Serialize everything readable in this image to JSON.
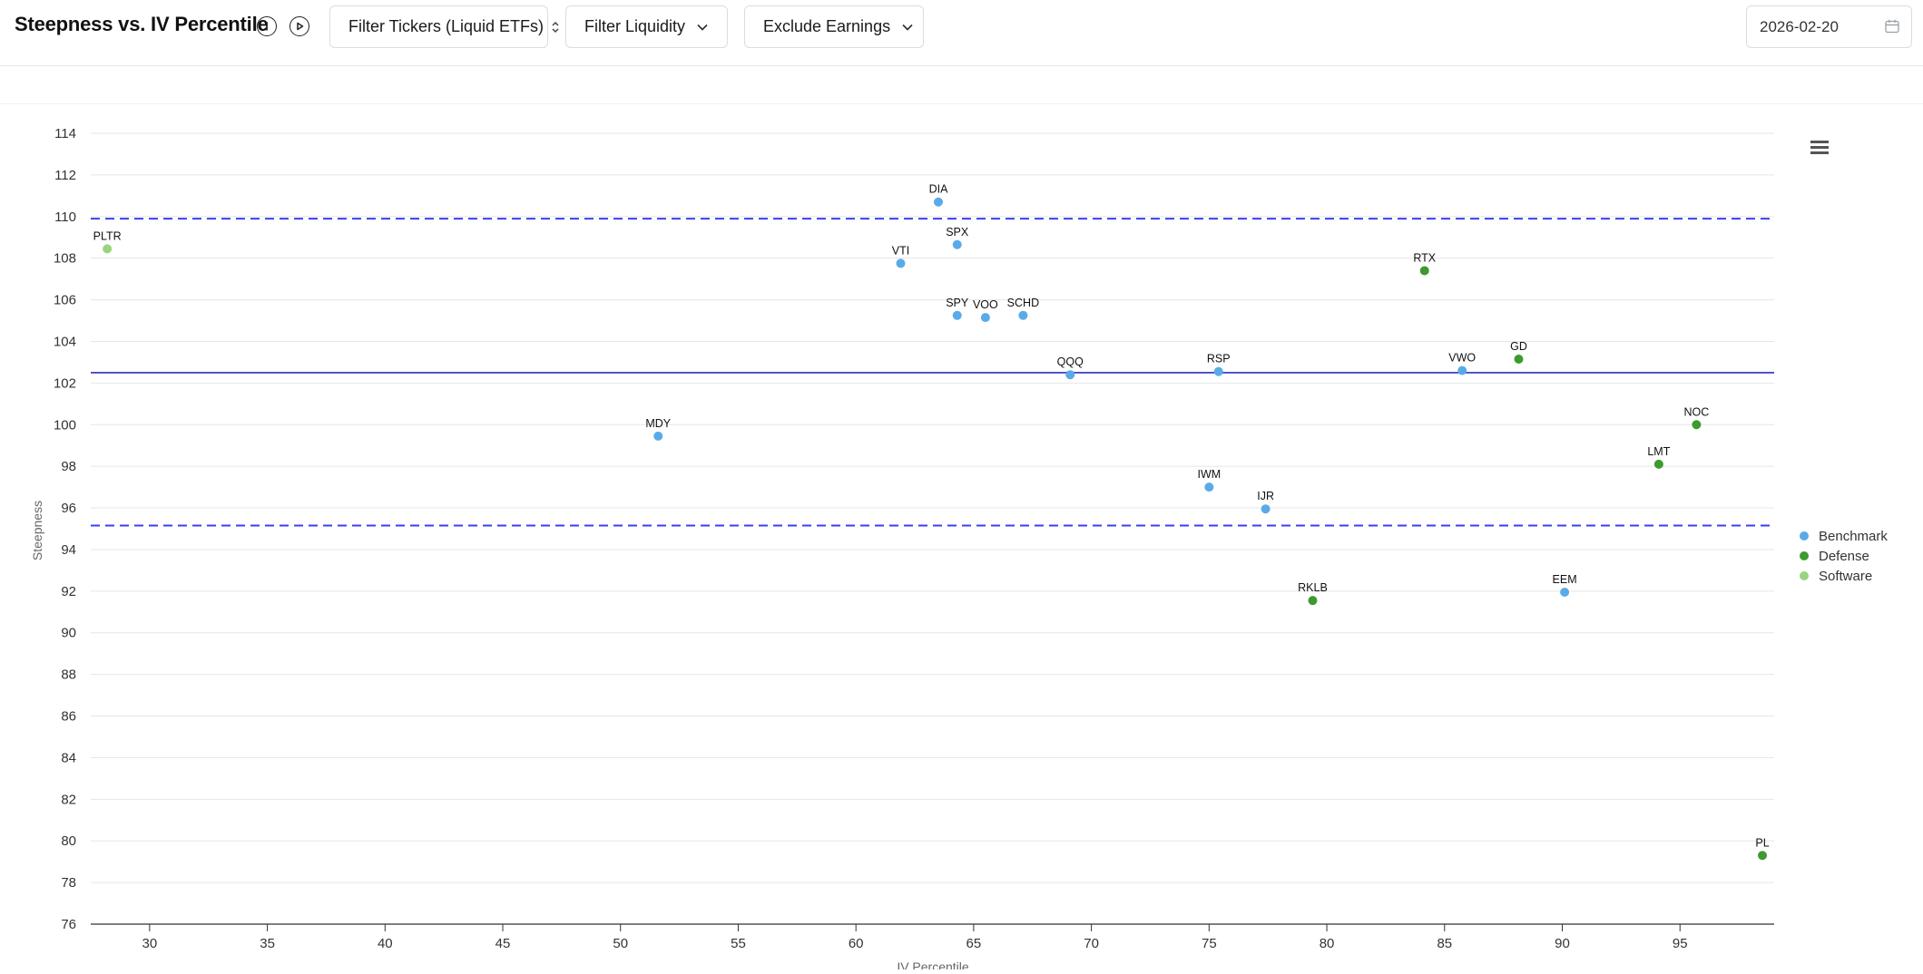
{
  "header": {
    "title": "Steepness vs. IV Percentile",
    "filter_tickers_label": "Filter Tickers (Liquid ETFs)",
    "filter_liquidity_label": "Filter Liquidity",
    "exclude_earnings_label": "Exclude Earnings",
    "date_value": "2026-02-20"
  },
  "icons": {
    "info": "info-icon",
    "play": "play-icon",
    "chevron": "chevron-down-icon",
    "sort": "sort-icon",
    "calendar": "calendar-icon",
    "menu": "hamburger-menu-icon"
  },
  "colors": {
    "Benchmark": "#5aaae8",
    "Defense": "#3d9a2e",
    "Software": "#98d67e",
    "mean_line": "#2b2fbf",
    "band_line": "#3b3ff0"
  },
  "chart_data": {
    "type": "scatter",
    "title": "",
    "xlabel": "IV Percentile",
    "ylabel": "Steepness",
    "xlim": [
      27.5,
      99
    ],
    "ylim": [
      76,
      114
    ],
    "x_ticks": [
      30,
      35,
      40,
      45,
      50,
      55,
      60,
      65,
      70,
      75,
      80,
      85,
      90,
      95
    ],
    "y_ticks": [
      76,
      78,
      80,
      82,
      84,
      86,
      88,
      90,
      92,
      94,
      96,
      98,
      100,
      102,
      104,
      106,
      108,
      110,
      112,
      114
    ],
    "grid": "horizontal",
    "legend_position": "right",
    "reference_lines": [
      {
        "kind": "mean",
        "y": 102.5,
        "style": "solid"
      },
      {
        "kind": "upper-band",
        "y": 109.9,
        "style": "dashed"
      },
      {
        "kind": "lower-band",
        "y": 95.15,
        "style": "dashed"
      }
    ],
    "series": [
      {
        "name": "Benchmark",
        "points": [
          {
            "label": "DIA",
            "x": 63.5,
            "y": 110.7
          },
          {
            "label": "SPX",
            "x": 64.3,
            "y": 108.65
          },
          {
            "label": "VTI",
            "x": 61.9,
            "y": 107.75
          },
          {
            "label": "SPY",
            "x": 64.3,
            "y": 105.25
          },
          {
            "label": "VOO",
            "x": 65.5,
            "y": 105.15
          },
          {
            "label": "SCHD",
            "x": 67.1,
            "y": 105.25
          },
          {
            "label": "QQQ",
            "x": 69.1,
            "y": 102.4
          },
          {
            "label": "RSP",
            "x": 75.4,
            "y": 102.55
          },
          {
            "label": "VWO",
            "x": 85.75,
            "y": 102.6
          },
          {
            "label": "MDY",
            "x": 51.6,
            "y": 99.45
          },
          {
            "label": "IWM",
            "x": 75.0,
            "y": 97.0
          },
          {
            "label": "IJR",
            "x": 77.4,
            "y": 95.95
          },
          {
            "label": "EEM",
            "x": 90.1,
            "y": 91.95
          }
        ]
      },
      {
        "name": "Defense",
        "points": [
          {
            "label": "RTX",
            "x": 84.15,
            "y": 107.4
          },
          {
            "label": "GD",
            "x": 88.15,
            "y": 103.15
          },
          {
            "label": "NOC",
            "x": 95.7,
            "y": 100.0
          },
          {
            "label": "LMT",
            "x": 94.1,
            "y": 98.1
          },
          {
            "label": "RKLB",
            "x": 79.4,
            "y": 91.55
          },
          {
            "label": "PL",
            "x": 98.5,
            "y": 79.3
          }
        ]
      },
      {
        "name": "Software",
        "points": [
          {
            "label": "PLTR",
            "x": 28.2,
            "y": 108.45
          }
        ]
      }
    ]
  }
}
